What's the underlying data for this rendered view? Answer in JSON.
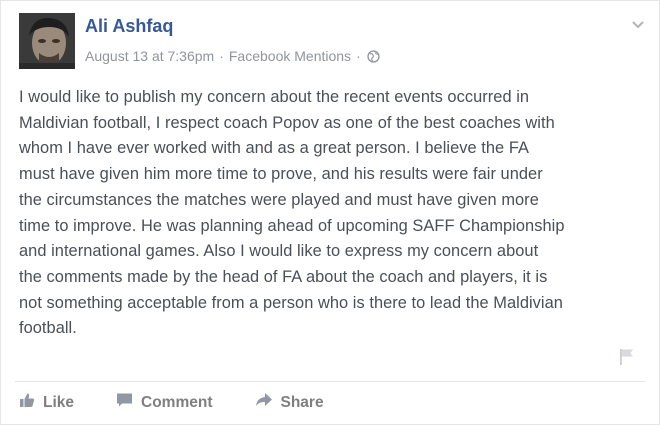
{
  "post": {
    "author": "Ali Ashfaq",
    "timestamp": "August 13 at 7:36pm",
    "separator": "·",
    "source": "Facebook Mentions",
    "privacy_icon": "globe-icon",
    "body": "I would like to publish my concern about the recent events occurred in\nMaldivian football, I respect coach Popov as one of the best coaches with\nwhom I have ever worked with and as a great person. I believe the FA\nmust have given him more time to prove, and his results were fair under\nthe circumstances the matches were played and must have given more\ntime to improve. He was planning ahead of upcoming SAFF Championship\nand international games. Also I would like to express my concern about\nthe comments made by the head of FA about the coach and players, it is\nnot something acceptable from a person who is there to lead the Maldivian\nfootball."
  },
  "actions": {
    "like_label": "Like",
    "comment_label": "Comment",
    "share_label": "Share"
  },
  "colors": {
    "author_link": "#365899",
    "meta_text": "#90949c",
    "body_text": "#4b4f56",
    "action_text": "#7f7f7f"
  }
}
